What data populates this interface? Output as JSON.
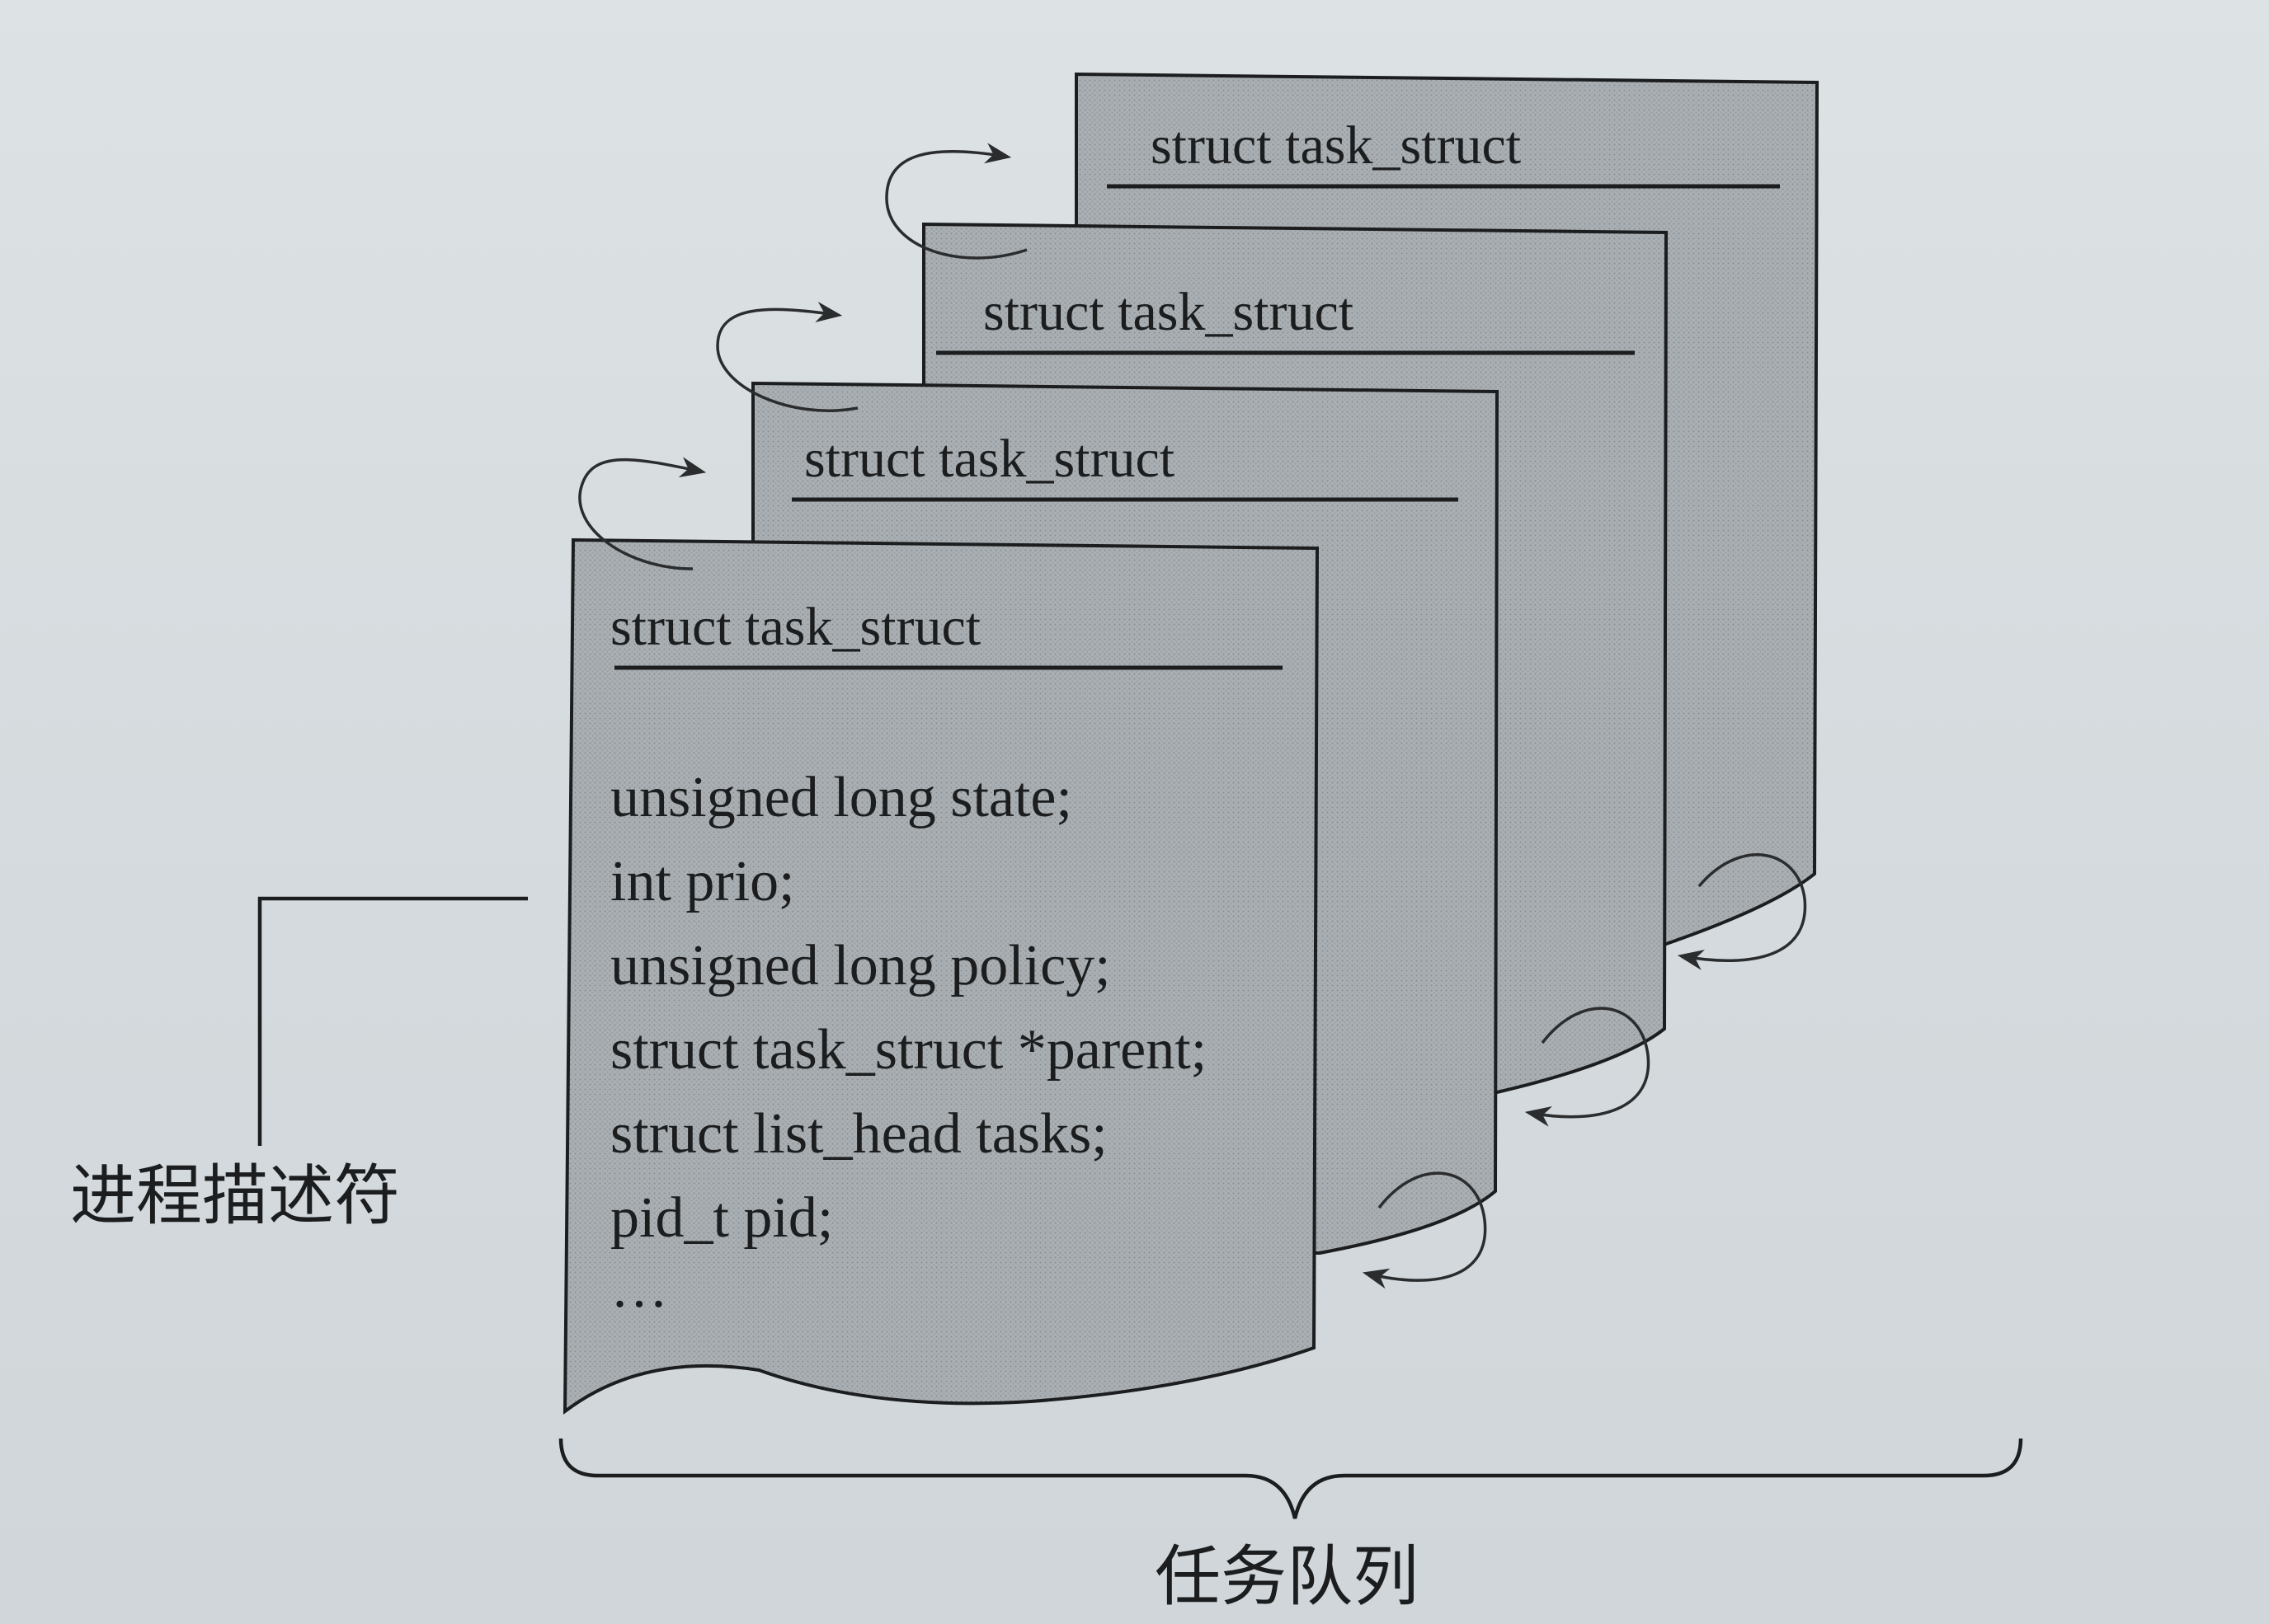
{
  "diagram": {
    "card_header": "struct task_struct",
    "fields": [
      "unsigned long state;",
      "int prio;",
      "unsigned long policy;",
      "struct task_struct *parent;",
      "struct list_head tasks;",
      "pid_t pid;",
      "…"
    ],
    "descriptor_label": "进程描述符",
    "queue_label": "任务队列",
    "colors": {
      "card_fill": "#a9afb2",
      "ink": "#1b1d1f",
      "background": "#d8dee1"
    }
  }
}
